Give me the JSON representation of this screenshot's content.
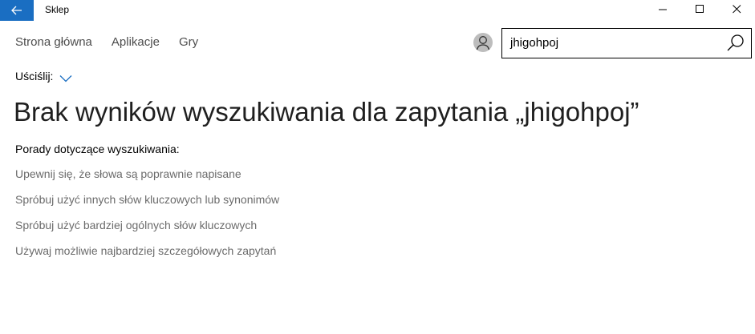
{
  "window": {
    "title": "Sklep"
  },
  "nav": {
    "items": [
      "Strona główna",
      "Aplikacje",
      "Gry"
    ]
  },
  "search": {
    "value": "jhigohpoj"
  },
  "refine": {
    "label": "Uściślij:"
  },
  "results": {
    "heading": "Brak wyników wyszukiwania dla zapytania „jhigohpoj”",
    "tips_title": "Porady dotyczące wyszukiwania:",
    "tips": [
      "Upewnij się, że słowa są poprawnie napisane",
      "Spróbuj użyć innych słów kluczowych lub synonimów",
      "Spróbuj użyć bardziej ogólnych słów kluczowych",
      "Używaj możliwie najbardziej szczegółowych zapytań"
    ]
  },
  "icons": {
    "back": "back-arrow-icon",
    "minimize": "minimize-icon",
    "maximize": "maximize-icon",
    "close": "close-icon",
    "avatar": "user-avatar-icon",
    "search": "search-icon",
    "refine": "chevron-down-icon"
  },
  "colors": {
    "accent": "#1a6ec2",
    "refine_chevron": "#1a6ec2"
  }
}
